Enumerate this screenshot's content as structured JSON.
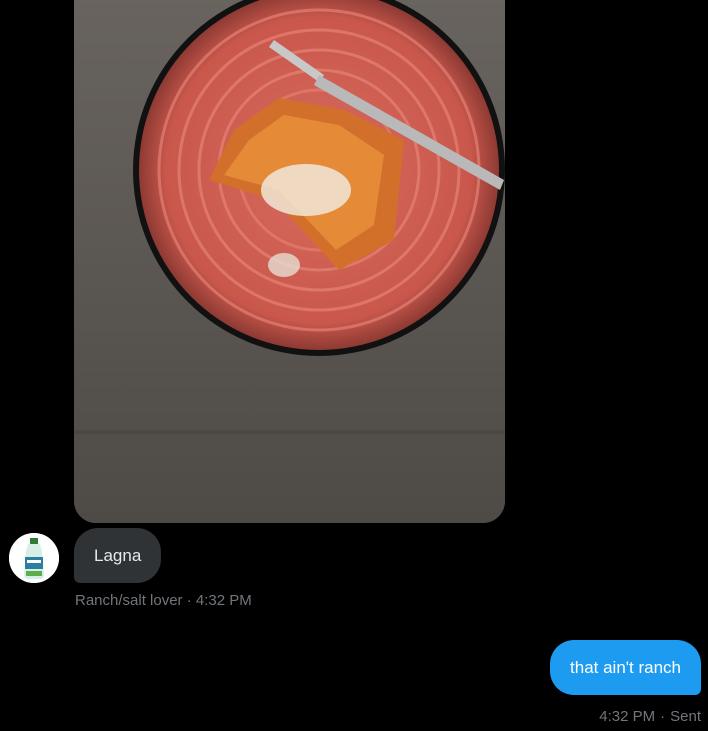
{
  "received_message": {
    "text": "Lagna",
    "sender": "Ranch/salt lover",
    "separator": "·",
    "time": "4:32 PM"
  },
  "sent_message": {
    "text": "that ain't ranch",
    "time": "4:32 PM",
    "separator": "·",
    "status": "Sent"
  },
  "colors": {
    "background": "#000000",
    "received_bubble": "#2f3336",
    "sent_bubble": "#1d9bf0",
    "meta_text": "#71767b"
  },
  "icons": {
    "avatar": "ranch-bottle-avatar"
  }
}
